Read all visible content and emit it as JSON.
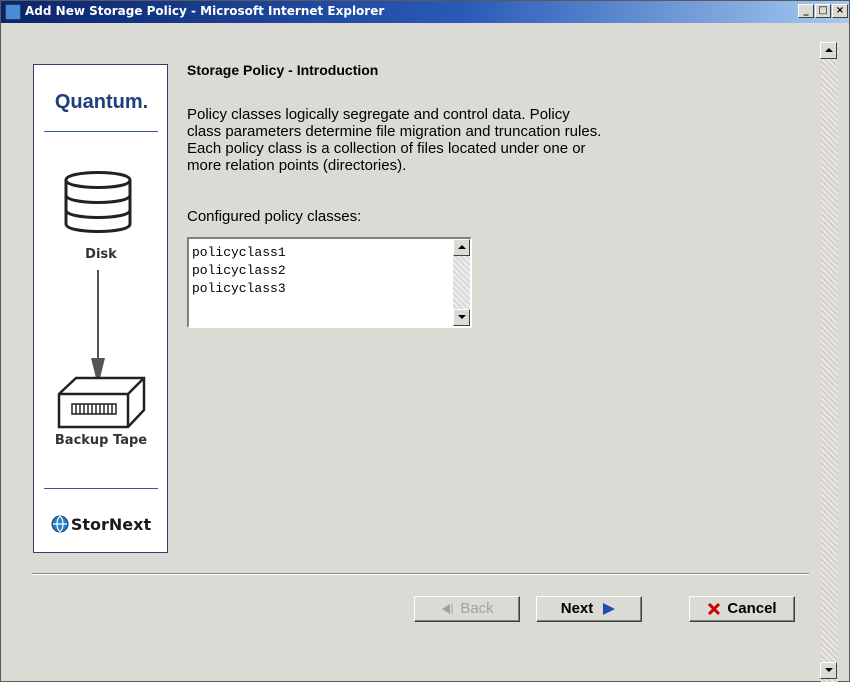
{
  "window": {
    "title": "Add New Storage Policy - Microsoft Internet Explorer",
    "minimize_glyph": "_",
    "maximize_glyph": "□",
    "close_glyph": "×"
  },
  "sidebar": {
    "brand": "Quantum.",
    "disk_label": "Disk",
    "tape_label": "Backup Tape",
    "product": "StorNext",
    "icons": [
      "disk-icon",
      "down-arrow-icon",
      "tape-drive-icon",
      "stornext-globe-icon"
    ]
  },
  "main": {
    "heading": "Storage Policy - Introduction",
    "paragraph_lines": [
      "Policy classes logically segregate and control data. Policy",
      "class parameters determine file migration and truncation rules.",
      "Each policy class is a collection of files located under one or",
      "more relation points (directories)."
    ],
    "configured_label": "Configured policy classes:",
    "policy_classes": [
      "policyclass1",
      "policyclass2",
      "policyclass3"
    ]
  },
  "buttons": {
    "back": "Back",
    "next": "Next",
    "cancel": "Cancel"
  },
  "colors": {
    "title_start": "#0a246a",
    "title_end": "#a6caf0",
    "window_bg": "#dcdad5",
    "brand_blue": "#1d3f7c",
    "next_arrow": "#1f4ea8",
    "cancel_x": "#cc0000"
  }
}
